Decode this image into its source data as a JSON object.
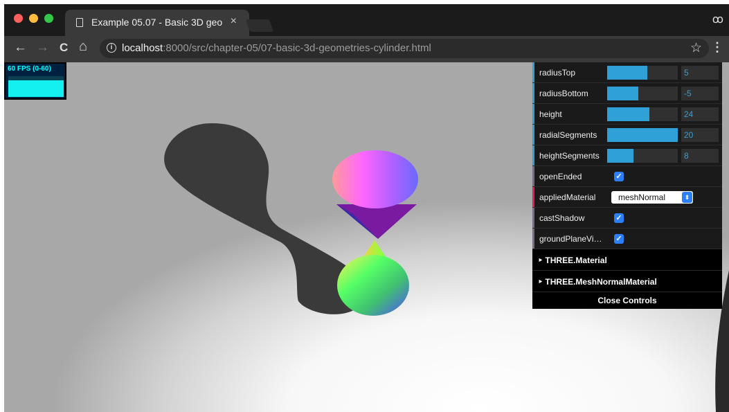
{
  "browser": {
    "tab_title": "Example 05.07 - Basic 3D geo",
    "tab_close": "×",
    "url_host": "localhost",
    "url_rest": ":8000/src/chapter-05/07-basic-3d-geometries-cylinder.html",
    "back_icon": "←",
    "forward_icon": "→",
    "reload_icon": "C",
    "home_icon": "⌂",
    "info_icon": "i",
    "bookmark_icon": "☆",
    "menu_icon": "⋮",
    "incognito_icon": "ꝏ",
    "traffic_lights": [
      "#fc605c",
      "#fdbc40",
      "#34c84a"
    ]
  },
  "stats": {
    "fps_label": "60 FPS (0-60)"
  },
  "controls": {
    "sliders": [
      {
        "label": "radiusTop",
        "value": "5",
        "fill": 0.57
      },
      {
        "label": "radiusBottom",
        "value": "-5",
        "fill": 0.44
      },
      {
        "label": "height",
        "value": "24",
        "fill": 0.6
      },
      {
        "label": "radialSegments",
        "value": "20",
        "fill": 1.0
      },
      {
        "label": "heightSegments",
        "value": "8",
        "fill": 0.37
      }
    ],
    "openEnded": {
      "label": "openEnded",
      "checked": true
    },
    "appliedMaterial": {
      "label": "appliedMaterial",
      "value": "meshNormal"
    },
    "castShadow": {
      "label": "castShadow",
      "checked": true
    },
    "groundPlaneVisible": {
      "label": "groundPlaneVi…",
      "checked": true
    },
    "folders": [
      "THREE.Material",
      "THREE.MeshNormalMaterial"
    ],
    "close_label": "Close Controls",
    "checkmark": "✓",
    "select_arrow": "⬍",
    "folder_arrow": "‣",
    "accent_color": "#2fa1d6"
  }
}
